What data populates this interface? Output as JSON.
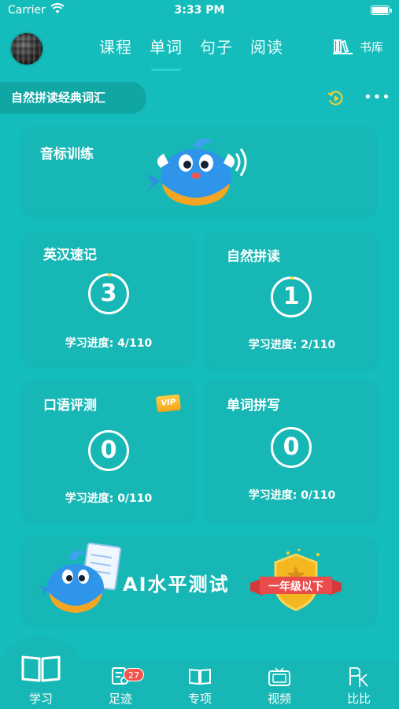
{
  "status_bar": {
    "carrier": "Carrier",
    "time": "3:33 PM"
  },
  "header": {
    "tabs": [
      {
        "label": "课程",
        "active": false
      },
      {
        "label": "单词",
        "active": true
      },
      {
        "label": "句子",
        "active": false
      },
      {
        "label": "阅读",
        "active": false
      }
    ],
    "library_label": "书库"
  },
  "book": {
    "title": "自然拼读经典词汇"
  },
  "cards": {
    "phonetic": {
      "title": "音标训练"
    },
    "quick_memory": {
      "title": "英汉速记",
      "count": "3",
      "progress": "学习进度: 4/110"
    },
    "phonics": {
      "title": "自然拼读",
      "count": "1",
      "progress": "学习进度: 2/110"
    },
    "oral": {
      "title": "口语评测",
      "badge": "VIP",
      "count": "0",
      "progress": "学习进度: 0/110"
    },
    "spelling": {
      "title": "单词拼写",
      "count": "0",
      "progress": "学习进度: 0/110"
    },
    "ai_test": {
      "title": "AI水平测试",
      "level_banner": "一年级以下"
    }
  },
  "bottom_nav": {
    "items": [
      {
        "label": "学习",
        "icon": "book-open-icon",
        "active": true
      },
      {
        "label": "足迹",
        "icon": "footprint-icon",
        "badge": "27"
      },
      {
        "label": "专项",
        "icon": "book-icon"
      },
      {
        "label": "视频",
        "icon": "tv-icon"
      },
      {
        "label": "比比",
        "icon": "pk-icon"
      }
    ]
  },
  "colors": {
    "background": "#14bdbb",
    "card": "#17b7b5",
    "accent": "#23d6c9",
    "badge": "#f2544e",
    "gold": "#f2b31c"
  }
}
